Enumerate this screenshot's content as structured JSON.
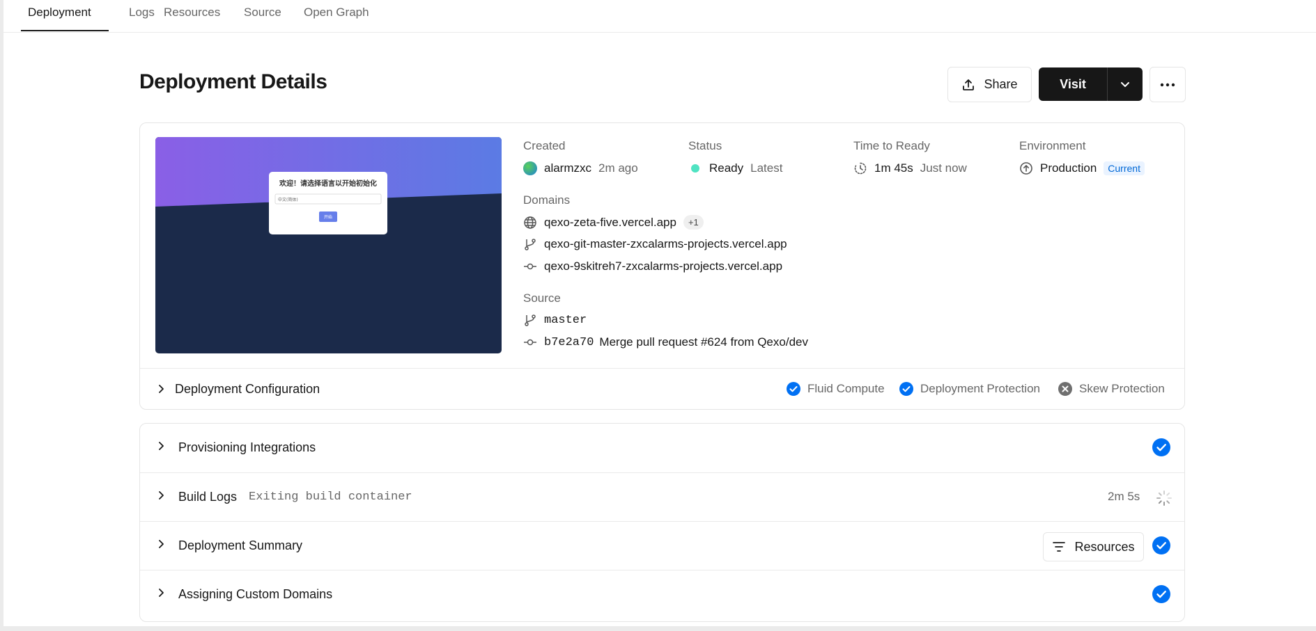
{
  "tabs": [
    {
      "label": "Deployment",
      "active": true
    },
    {
      "label": "Logs"
    },
    {
      "label": "Resources"
    },
    {
      "label": "Source"
    },
    {
      "label": "Open Graph"
    }
  ],
  "header": {
    "title": "Deployment Details",
    "share_label": "Share",
    "visit_label": "Visit"
  },
  "preview": {
    "heading": "欢迎！请选择语言以开始初始化",
    "select_value": "中文(简体)",
    "button_label": "开始",
    "gradient_colors": [
      "#8a5fe6",
      "#5b7be4"
    ],
    "dark_color": "#1b2a4a"
  },
  "meta": {
    "created_label": "Created",
    "created_user": "alarmzxc",
    "created_time": "2m ago",
    "status_label": "Status",
    "status_value": "Ready",
    "status_tag": "Latest",
    "ttr_label": "Time to Ready",
    "ttr_value": "1m 45s",
    "ttr_when": "Just now",
    "env_label": "Environment",
    "env_value": "Production",
    "env_badge": "Current"
  },
  "domains": {
    "label": "Domains",
    "primary": "qexo-zeta-five.vercel.app",
    "extra_count": "+1",
    "branch_domain": "qexo-git-master-zxcalarms-projects.vercel.app",
    "commit_domain": "qexo-9skitreh7-zxcalarms-projects.vercel.app"
  },
  "source": {
    "label": "Source",
    "branch": "master",
    "commit_hash": "b7e2a70",
    "commit_message": "Merge pull request #624 from Qexo/dev"
  },
  "config": {
    "title": "Deployment Configuration",
    "features": [
      {
        "label": "Fluid Compute",
        "enabled": true
      },
      {
        "label": "Deployment Protection",
        "enabled": true
      },
      {
        "label": "Skew Protection",
        "enabled": false
      }
    ]
  },
  "steps": {
    "provisioning": {
      "title": "Provisioning Integrations",
      "done": true
    },
    "build_logs": {
      "title": "Build Logs",
      "detail": "Exiting build container",
      "duration": "2m 5s",
      "in_progress": true
    },
    "summary": {
      "title": "Deployment Summary",
      "resources_label": "Resources",
      "done": true
    },
    "domains": {
      "title": "Assigning Custom Domains",
      "done": true
    }
  },
  "colors": {
    "accent_blue": "#0070f3",
    "ready_green": "#50e3c2",
    "dark": "#171717"
  }
}
